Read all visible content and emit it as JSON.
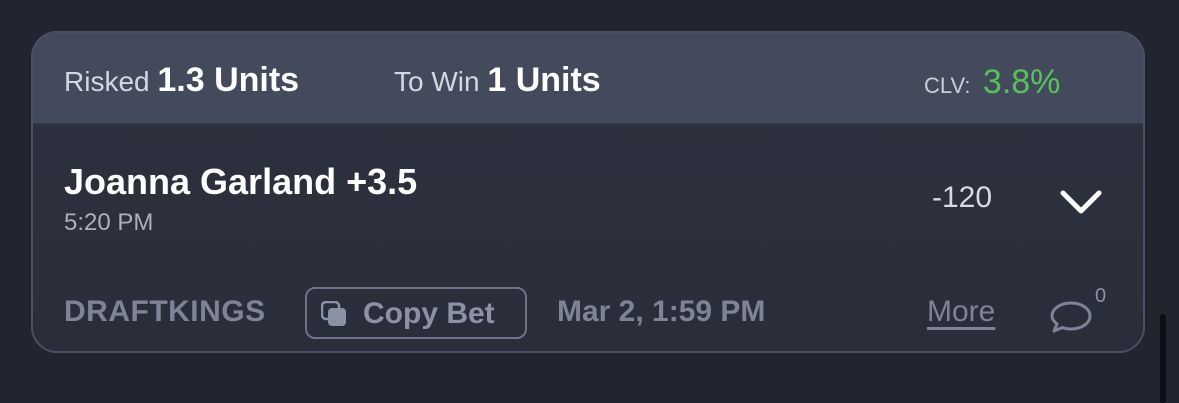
{
  "header": {
    "risked_label": "Risked",
    "risked_value": "1.3 Units",
    "towin_label": "To Win",
    "towin_value": "1 Units",
    "clv_label": "CLV:",
    "clv_value": "3.8%"
  },
  "bet": {
    "pick": "Joanna Garland +3.5",
    "time": "5:20 PM",
    "odds": "-120"
  },
  "footer": {
    "sportsbook": "DRAFTKINGS",
    "copy_label": "Copy Bet",
    "placed_date": "Mar 2, 1:59 PM",
    "more_label": "More",
    "comment_count": "0"
  },
  "icons": {
    "expand": "chevron-down-icon",
    "copy": "copy-icon",
    "comment": "comment-bubble-icon"
  },
  "colors": {
    "background": "#22252f",
    "header": "#434a5b",
    "clv_positive": "#56c15a",
    "muted": "#7c8496"
  }
}
